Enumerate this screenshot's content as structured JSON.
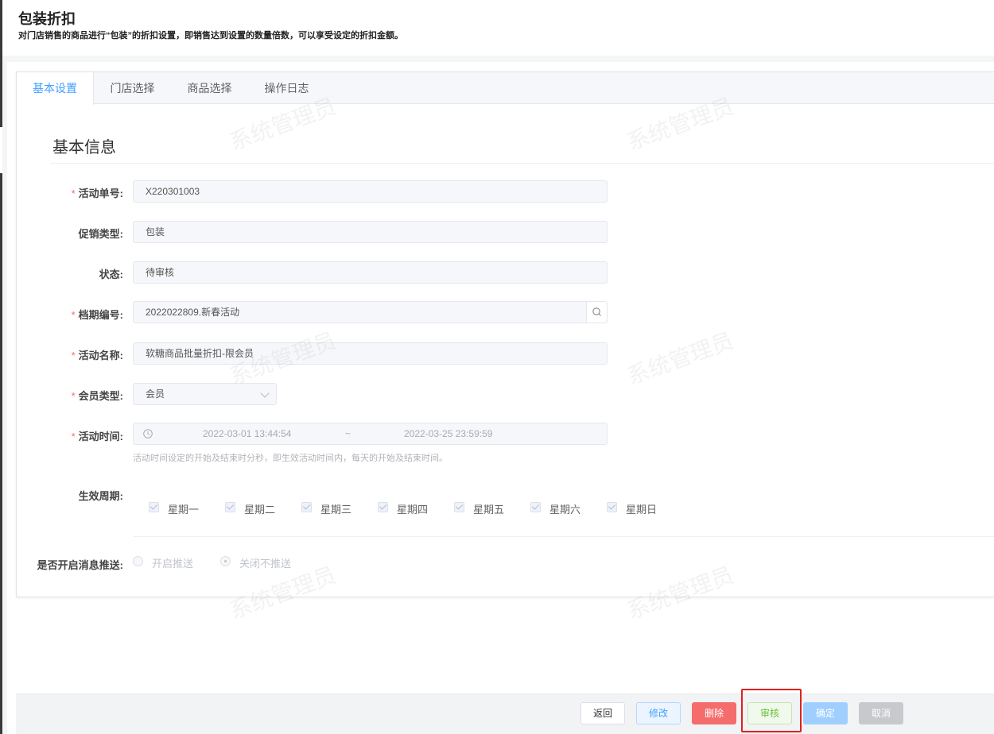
{
  "header": {
    "title": "包装折扣",
    "description": "对门店销售的商品进行“包装”的折扣设置，即销售达到设置的数量倍数，可以享受设定的折扣金额。"
  },
  "tabs": [
    {
      "label": "基本设置",
      "active": true
    },
    {
      "label": "门店选择",
      "active": false
    },
    {
      "label": "商品选择",
      "active": false
    },
    {
      "label": "操作日志",
      "active": false
    }
  ],
  "section_title": "基本信息",
  "form": {
    "activity_no": {
      "label": "活动单号:",
      "required": true,
      "value": "X220301003"
    },
    "promo_type": {
      "label": "促销类型:",
      "required": false,
      "value": "包装"
    },
    "status": {
      "label": "状态:",
      "required": false,
      "value": "待审核"
    },
    "schedule_no": {
      "label": "档期编号:",
      "required": true,
      "value": "2022022809.新春活动"
    },
    "activity_name": {
      "label": "活动名称:",
      "required": true,
      "value": "软糖商品批量折扣-限会员"
    },
    "member_type": {
      "label": "会员类型:",
      "required": true,
      "value": "会员"
    },
    "activity_time": {
      "label": "活动时间:",
      "required": true,
      "start": "2022-03-01 13:44:54",
      "separator": "~",
      "end": "2022-03-25 23:59:59",
      "hint": "活动时间设定的开始及结束时分秒，即生效活动时间内，每天的开始及结束时间。"
    },
    "effective_period": {
      "label": "生效周期:",
      "days": [
        {
          "label": "星期一",
          "checked": true
        },
        {
          "label": "星期二",
          "checked": true
        },
        {
          "label": "星期三",
          "checked": true
        },
        {
          "label": "星期四",
          "checked": true
        },
        {
          "label": "星期五",
          "checked": true
        },
        {
          "label": "星期六",
          "checked": true
        },
        {
          "label": "星期日",
          "checked": true
        }
      ]
    },
    "push": {
      "label": "是否开启消息推送:",
      "options": [
        {
          "label": "开启推送",
          "selected": false
        },
        {
          "label": "关闭不推送",
          "selected": true
        }
      ]
    }
  },
  "watermark": "系统管理员",
  "buttons": {
    "back": "返回",
    "edit": "修改",
    "delete": "删除",
    "audit": "审核",
    "confirm": "确定",
    "cancel": "取消"
  },
  "colors": {
    "primary": "#409eff",
    "danger": "#f56c6c",
    "success": "#67c23a",
    "highlight": "#e02020"
  }
}
